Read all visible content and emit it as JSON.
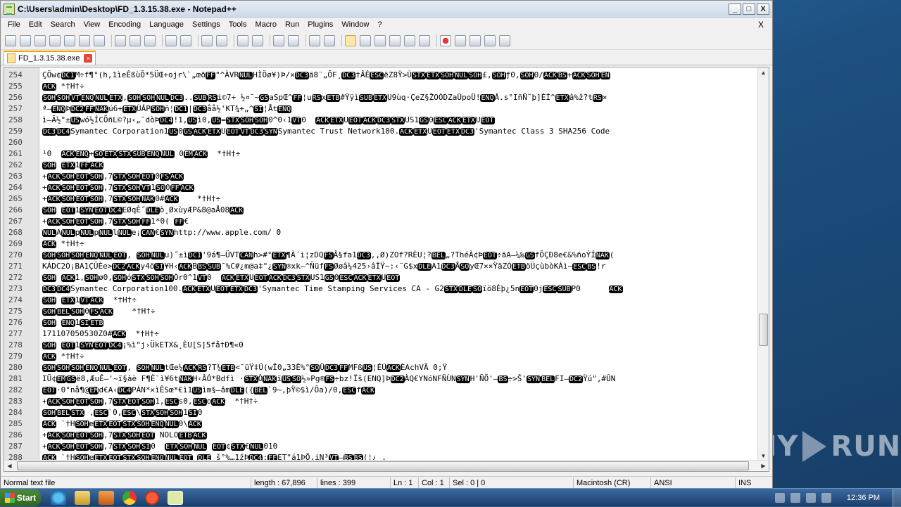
{
  "window": {
    "title": "C:\\Users\\admin\\Desktop\\FD_1.3.15.38.exe - Notepad++",
    "minimize": "_",
    "maximize": "□",
    "close": "X"
  },
  "menu": {
    "items": [
      "File",
      "Edit",
      "Search",
      "View",
      "Encoding",
      "Language",
      "Settings",
      "Tools",
      "Macro",
      "Run",
      "Plugins",
      "Window",
      "?"
    ],
    "close_doc": "X"
  },
  "tab": {
    "label": "FD_1.3.15.38.exe",
    "close": "×"
  },
  "editor": {
    "lines": [
      {
        "n": "254",
        "t": "ÇÖw¢[DC1]M÷f¶°(h,1ìeÊßùÕ*5ÜŒ+ojr\\`„œð[FF]\"^ÀVR[NUL]HÌÖø¥)Þ/×[DC3]ä8¨„ÕF¸[DC3]†ÂÊ[ESC]ëZ8Ÿ>Ù[STX][ETX][SOH][NUL][SOH]£,[SOH]ƒ0,[SOH]0/[ACK][BS]+[ACK][SOH][EN]"
      },
      {
        "n": "255",
        "t": "[ACK] *†H†÷"
      },
      {
        "n": "256",
        "t": "[SOH][SOH][VT][ENQ][NUL][ETX],[SOH][SOH][NUL][DC3]..[SUB][RS]i©7÷ ½¤¯~[GS]aSpŒ^[FF]¦u[RS]x[ETB]#Ÿÿì[SUB][ETX]U9ùq·ÇeZ§ŽOÒDZaÛpoÜ![ENQ]Â.s°IñÑ˜þ]ÉÍ^[ETX]â%ž?t[RS]×"
      },
      {
        "n": "257",
        "t": "ª—[ENQ]Þ[DC2][FF][NAK]ú6+[ETX]ÙÁP[SOH]ñ¦[DC1]|[DC3]åå½'KT¾+„^[SI]¦Åt[ENQ]"
      },
      {
        "n": "258",
        "t": "ì–Ã½\"±[US]wó½ÍCÕñL©?µ‹„¯dòÞ[DC4]!1,[US]ì0,[US]=[STX][SOH][SOH]0^0‹1[VT]0  [ACK][ETX]U[EOT][ACK][DC3][STX]US1[GS]0[ESC][ACK][ETX]U[EOT]"
      },
      {
        "n": "259",
        "t": "[DC3][DC4]Symantec Corporation1[US]0[GS][ACK][ETX]U[EOT][VT][DC3][SYN]Symantec Trust Network100.[ACK][ETX]U[EOT][ETX][DC3]'Symantec Class 3 SHA256 Code"
      },
      {
        "n": "260",
        "t": ""
      },
      {
        "n": "261",
        "t": "¹0  [ACK][ENQ]+[SO][ETX][STX][SUB][ENQ][NUL] 0[EM][ACK]  *†H†÷"
      },
      {
        "n": "262",
        "t": "[SOH] [ETX]1[FF][ACK]"
      },
      {
        "n": "263",
        "t": "+[ACK][SOH][EOT][SOH],7[STX][SOH][EOT]0[FS][ACK]"
      },
      {
        "n": "264",
        "t": "+[ACK][SOH][EOT][SOH],7[STX][SOH][VT]1[SO]0[FF][ACK]"
      },
      {
        "n": "265",
        "t": "+[ACK][SOH][EOT][SOH],7[STX][SOH][NAK]0#[ACK]    *†H†÷"
      },
      {
        "n": "266",
        "t": "[SOH] [EOT]1[SYN][EOT][DC4]EØqÈ˝[DLE]ò¸ØxùyÆP&8@aÅ08[ACK]"
      },
      {
        "n": "267",
        "t": "+[ACK][SOH][EOT][SOH],7[STX][SOH][FF]1*0( [FF]€"
      },
      {
        "n": "268",
        "t": "[NUL]A[NUL]p[NUL]p[NUL]l[NUL]e¡[CAN]€[SYN]http://www.apple.com/ 0"
      },
      {
        "n": "269",
        "t": "[ACK] *†H†÷"
      },
      {
        "n": "270",
        "t": "[SOH][SOH][SOH][ENQ][NUL][EOT], [SOH][NUL]u)˝±ì[DC1]'9á¶–ÜVT[CAN]h>#°[ETX]¶À´i¦zDQ[FS]Â§fa1[DC3],,Ø)ZOf?RÈU¦?[BEL]„?ThéÀ¢Þ[EOT]÷äA–¼‰[GS]fÕÇÐ8e€&%ñoÝÍ[NAK]("
      },
      {
        "n": "271",
        "t": "KÁDC2Ò¡BA1ÇÜÈe>[DC2][ACK]y4ö[SI]¥H‹[ACK]B[BS][SUB]¯%C#¿m@a‡\"¿[SYN]®xk–^Ñüf[FS]Øøâ¼425›âÏŸ~:‹¨G$x[DLE]A1[DC3]Å[SO]yŒ7××ŸäZÒ[ETB]öÜçùbòKÁì~[ESC][BS]!r"
      },
      {
        "n": "272",
        "t": "[SOH] [ACK]1,[SOH]ø0,[SOH]ó[STX][SOH][SOH]Òr0^1[VT]0  [ACK][ETX]U[EOT][ACK][DC3][STX]US1[GS]0[ESC][ACK][ETX]U[EOT]"
      },
      {
        "n": "273",
        "t": "[DC3][DC4]Symantec Corporation100.[ACK][ETX]U[EOT][ETX][DC3]'Symantec Time Stamping Services CA - G2[STX][DLE][SO]ïö8Èþ¿5n[EOT]0j[ESC][SUB]P0      [ACK]"
      },
      {
        "n": "274",
        "t": "[SOH] [ETX]1[VT][ACK]  *†H†÷"
      },
      {
        "n": "275",
        "t": "[SOH][BEL][SOH]0[FS][ACK]    *†H†÷"
      },
      {
        "n": "276",
        "t": "[SOH] [ENQ]1[SI][ETB]"
      },
      {
        "n": "277",
        "t": "171107050530Z0#[ACK]  *†H†÷"
      },
      {
        "n": "278",
        "t": "[SOH] [EOT]1[SYN][EOT][DC4]¡%ì\"j›ÜkETX&¸ÈU[S]5få†Ð¶«0"
      },
      {
        "n": "279",
        "t": "[ACK] *†H†÷"
      },
      {
        "n": "280",
        "t": "[SOH][SOH][SOH][ENQ][NUL][EOT], [SOH][NUL]tŒe¼[ACK][RS]?T¾[ETB]<¯üŸ‡Ü(wÎ0„33È%°[SO]Ü[DC3][FF]MFß[US]¦ÉÚ[ACK]ÈAchVÃ 0;Ÿ"
      },
      {
        "n": "281",
        "t": "IÜ¢[EM][GS]ë8,ÆuÊ–'~ï§àè F¶È`ì¥6t[NAK]H‹ÂÓ*Bdfì ·[STX]Ô[NAK]ï[US][SO]½»Pg®[FS]÷bz!Ïš(ENQ]Þ[DC2]ÀQ€YNóNFÑÙN[SYN]H'ÑÖ'–[BS]÷>Š'[SYN][BEL]FI–[DC2]Ÿú\",#ÛN"
      },
      {
        "n": "282",
        "t": "[EOT]·0°nå¶@[EM]d€A‹[DC4]PÁN*×ìÊSœ*€ì1[US]ìm§–âm[DLE]({[BEL]`9~,þŸ©$ì/Ôa)/0,[ESC]f[ACK]"
      },
      {
        "n": "283",
        "t": "+[ACK][SOH][EOT][SOH],7[STX][EOT][SOH]1,[ESC]s0,[ESC]o[ACK]  *†H†÷"
      },
      {
        "n": "284",
        "t": "[SOH][BEL][STX] ,[ESC]`0,[ESC]\\[STX][SOH][SOH]1[SI]0"
      },
      {
        "n": "285",
        "t": "[ACK] `†H[SOH]e[ETX][EOT][STX][SOH][ENQ][NUL]0\\[ACK]"
      },
      {
        "n": "286",
        "t": "+[ACK][SOH][EOT][SOH],7[STX][SOH][EOT] NOLO[ETB][ACK]"
      },
      {
        "n": "287",
        "t": "+[ACK][SOH][EOT][SOH],7[STX][SOH][SI]0  [ETX][SOH][NUL] [EOT]¢[STX]€[NUL]010"
      },
      {
        "n": "288",
        "t": "[ACK] `†H[SOH]e[ETX][EOT][STX][SOH][ENQ][NUL][EOT] [DLE] š°%…1žÞ[DC4]:[FF]ET\"á1ÞÕ.iN³[VT]–[BS][BS](¦¿ ,"
      }
    ]
  },
  "status": {
    "file_type": "Normal text file",
    "length": "length : 67,896",
    "lines": "lines : 399",
    "ln": "Ln : 1",
    "col": "Col : 1",
    "sel": "Sel : 0 | 0",
    "eol": "Macintosh (CR)",
    "encoding": "ANSI",
    "ins": "INS"
  },
  "taskbar": {
    "start": "Start",
    "clock": "12:36 PM"
  },
  "watermark": "ANY RUN",
  "colors": {
    "control_char_bg": "#000000",
    "control_char_fg": "#ffffff",
    "tab_accent": "#f5a300"
  }
}
